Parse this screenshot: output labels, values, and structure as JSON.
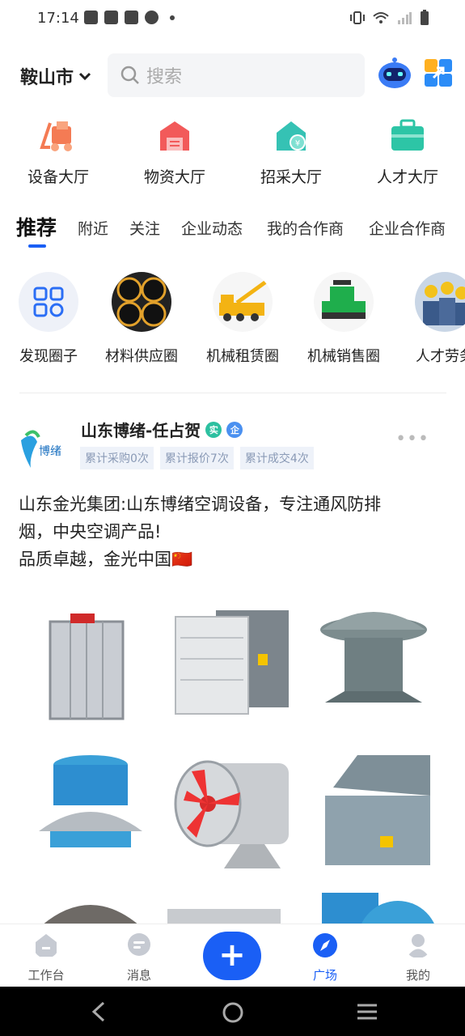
{
  "status": {
    "time": "17:14"
  },
  "header": {
    "city": "鞍山市",
    "search_placeholder": "搜索"
  },
  "quick_entries": [
    {
      "label": "设备大厅",
      "icon": "forklift-icon",
      "color": "#f47b54"
    },
    {
      "label": "物资大厅",
      "icon": "warehouse-icon",
      "color": "#f25a5a"
    },
    {
      "label": "招采大厅",
      "icon": "house-yen-icon",
      "color": "#35c2b4"
    },
    {
      "label": "人才大厅",
      "icon": "briefcase-icon",
      "color": "#2dc5a6"
    }
  ],
  "tabs": [
    {
      "label": "推荐",
      "active": true
    },
    {
      "label": "附近"
    },
    {
      "label": "关注"
    },
    {
      "label": "企业动态"
    },
    {
      "label": "我的合作商"
    },
    {
      "label": "企业合作商"
    }
  ],
  "circles": [
    {
      "label": "发现圈子",
      "icon": "grid-icon"
    },
    {
      "label": "材料供应圈",
      "icon": "pipes-image"
    },
    {
      "label": "机械租赁圈",
      "icon": "crane-truck-image"
    },
    {
      "label": "机械销售圈",
      "icon": "paver-image"
    },
    {
      "label": "人才劳务",
      "icon": "workers-image"
    }
  ],
  "post": {
    "author": "山东博绪-任占贺",
    "badge_real": "实",
    "badge_company": "企",
    "avatar_text": "博绪",
    "tags": [
      "累计采购0次",
      "累计报价7次",
      "累计成交4次"
    ],
    "text_line1": "山东金光集团:山东博绪空调设备，专注通风防排",
    "text_line2": "烟，中央空调产品!",
    "text_line3": "品质卓越，金光中国🇨🇳",
    "images": [
      "fire-damper",
      "exhaust-fan-box",
      "roof-fan",
      "blue-roof-fan",
      "axial-fan",
      "square-roof-fan",
      "fan-7",
      "fan-8",
      "fan-9"
    ]
  },
  "bottom_nav": [
    {
      "label": "工作台",
      "icon": "workbench-icon"
    },
    {
      "label": "消息",
      "icon": "message-icon"
    },
    {
      "label": "广场",
      "icon": "compass-icon",
      "active": true
    },
    {
      "label": "我的",
      "icon": "profile-icon"
    }
  ],
  "colors": {
    "accent": "#1a5ff5"
  }
}
